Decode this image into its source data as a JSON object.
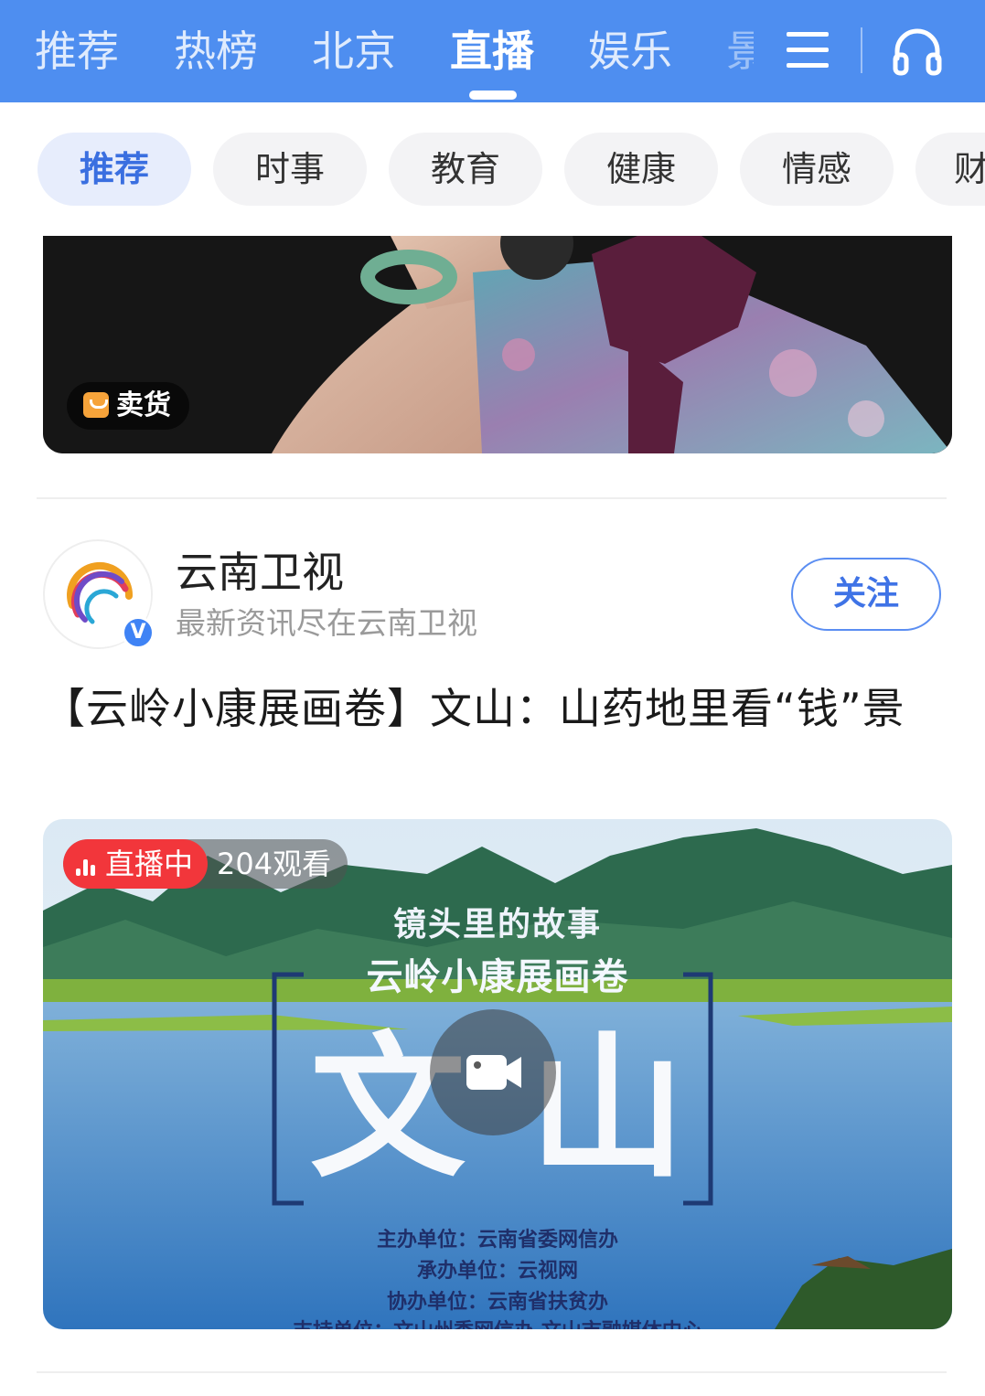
{
  "nav": {
    "tabs": [
      {
        "label": "推荐"
      },
      {
        "label": "热榜"
      },
      {
        "label": "北京"
      },
      {
        "label": "直播"
      },
      {
        "label": "娱乐"
      },
      {
        "label": "景"
      }
    ],
    "active_tab": "直播",
    "menu_icon": "menu-icon",
    "audio_icon": "headphone-icon",
    "accent_color": "#4e8ef0"
  },
  "chips": [
    {
      "label": "推荐"
    },
    {
      "label": "时事"
    },
    {
      "label": "教育"
    },
    {
      "label": "健康"
    },
    {
      "label": "情感"
    },
    {
      "label": "财"
    }
  ],
  "card1": {
    "badge_label": "卖货",
    "badge_icon": "shopping-bag-icon"
  },
  "post": {
    "account_name": "云南卫视",
    "account_desc": "最新资讯尽在云南卫视",
    "verified_mark": "V",
    "follow_label": "关注",
    "headline": "【云岭小康展画卷】文山：山药地里看“钱”景",
    "live": {
      "status_label": "直播中",
      "viewers_label": "204观看"
    },
    "poster": {
      "line1": "镜头里的故事",
      "line2": "云岭小康展画卷",
      "big_title": "文山",
      "credits": [
        "主办单位：云南省委网信办",
        "承办单位：云视网",
        "协办单位：云南省扶贫办",
        "支持单位：文山州委网信办  文山市融媒体中心"
      ]
    },
    "play_icon": "video-camera-icon"
  }
}
